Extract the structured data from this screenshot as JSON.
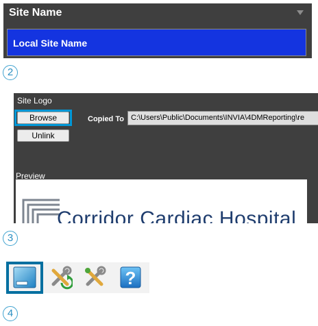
{
  "site_name_panel": {
    "header": "Site Name",
    "value": "Local Site Name"
  },
  "steps": [
    "2",
    "3",
    "4"
  ],
  "site_logo_panel": {
    "title": "Site Logo",
    "browse_label": "Browse",
    "unlink_label": "Unlink",
    "copied_to_label": "Copied To",
    "copied_to_path": "C:\\Users\\Public\\Documents\\INVIA\\4DMReporting\\re",
    "preview_label": "Preview",
    "preview_logo_text": "Corridor Cardiac Hospital"
  },
  "toolbar": {
    "buttons": [
      {
        "icon": "site-settings-icon",
        "selected": true
      },
      {
        "icon": "tools-green-icon",
        "selected": false
      },
      {
        "icon": "tools-icon",
        "selected": false
      },
      {
        "icon": "help-icon",
        "selected": false
      }
    ]
  },
  "colors": {
    "panel_bg": "#3f3f3f",
    "selected_field": "#1434e0",
    "highlight": "#0098d8",
    "step_circle": "#3fa2cf"
  }
}
